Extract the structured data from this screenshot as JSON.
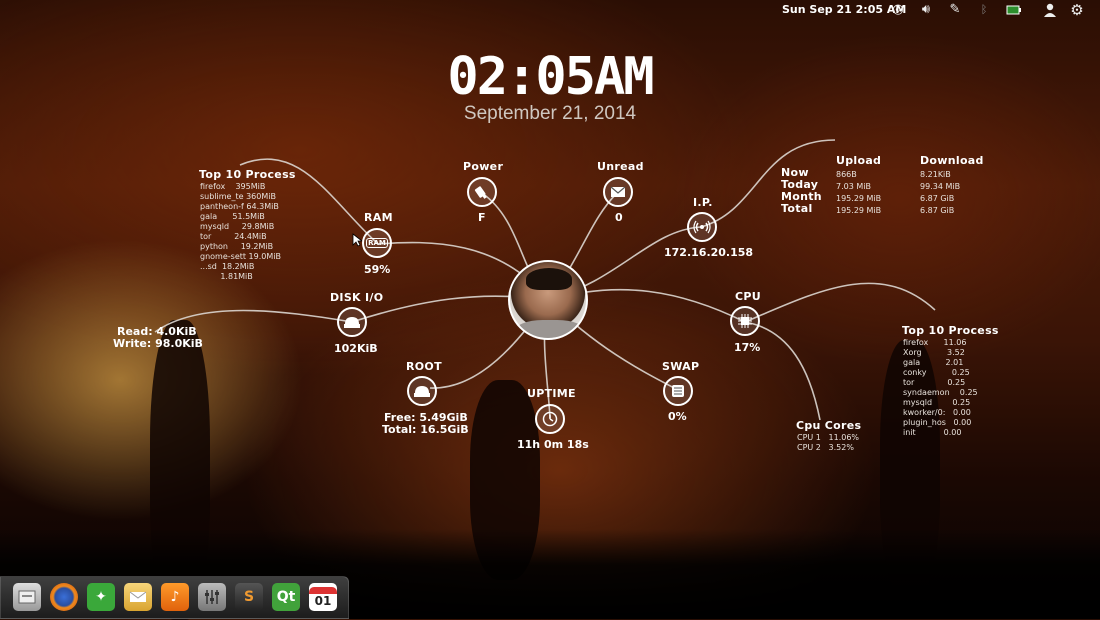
{
  "panel": {
    "clock": "Sun Sep 21  2:05 AM",
    "icons": [
      "network-icon",
      "volume-icon",
      "pen-icon",
      "bluetooth-icon",
      "battery-icon",
      "user-icon",
      "gear-icon"
    ]
  },
  "clock": {
    "time": "02:05AM",
    "date": "September 21, 2014"
  },
  "power": {
    "label": "Power",
    "value": "F"
  },
  "unread": {
    "label": "Unread",
    "value": "0"
  },
  "ip": {
    "label": "I.P.",
    "value": "172.16.20.158"
  },
  "ram": {
    "label": "RAM",
    "icon_text": "RAM",
    "value": "59%"
  },
  "disk": {
    "label": "DISK I/O",
    "value": "102KiB",
    "read": "Read: 4.0KiB",
    "write": "Write: 98.0KiB"
  },
  "root": {
    "label": "ROOT",
    "free": "Free: 5.49GiB",
    "total": "Total: 16.5GiB"
  },
  "uptime": {
    "label": "UPTIME",
    "value": "11h 0m 18s"
  },
  "swap": {
    "label": "SWAP",
    "value": "0%"
  },
  "cpu": {
    "label": "CPU",
    "value": "17%"
  },
  "cpu_cores": {
    "label": "Cpu Cores",
    "rows": [
      "CPU 1   11.06%",
      "CPU 2   3.52%"
    ]
  },
  "top_mem": {
    "label": "Top 10 Process",
    "rows": [
      "firefox    395MiB",
      "sublime_te 360MiB",
      "pantheon-f 64.3MiB",
      "gala      51.5MiB",
      "mysqld     29.8MiB",
      "tor         24.4MiB",
      "python     19.2MiB",
      "gnome-sett 19.0MiB",
      "...sd  18.2MiB",
      "        1.81MiB"
    ]
  },
  "top_cpu": {
    "label": "Top 10 Process",
    "rows": [
      "firefox      11.06",
      "Xorg          3.52",
      "gala          2.01",
      "conky          0.25",
      "tor             0.25",
      "syndaemon    0.25",
      "mysqld        0.25",
      "kworker/0:   0.00",
      "plugin_hos   0.00",
      "init           0.00"
    ]
  },
  "net": {
    "upload_label": "Upload",
    "download_label": "Download",
    "periods": [
      "Now",
      "Today",
      "Month",
      "Total"
    ],
    "upload": [
      "866B",
      "7.03 MiB",
      "195.29 MiB",
      "195.29 MiB"
    ],
    "download": [
      "8.21KiB",
      "99.34 MiB",
      "6.87 GiB",
      "6.87 GiB"
    ]
  },
  "dock": {
    "calendar_day": "01",
    "qt_label": "Qt"
  }
}
